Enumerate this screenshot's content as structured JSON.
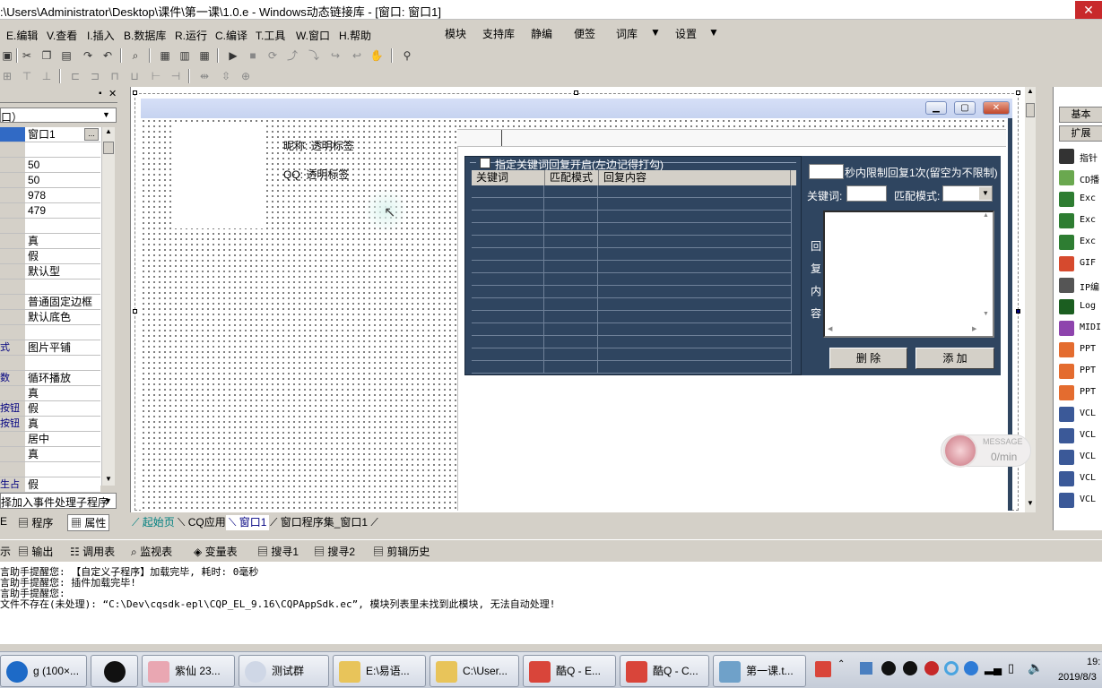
{
  "title": ":\\Users\\Administrator\\Desktop\\课件\\第一课\\1.0.e - Windows动态链接库 - [窗口: 窗口1]",
  "menu": {
    "left": [
      "E.编辑",
      "V.查看",
      "I.插入",
      "B.数据库",
      "R.运行",
      "C.编译",
      "T.工具",
      "W.窗口",
      "H.帮助"
    ],
    "right": [
      "模块",
      "支持库",
      "静编",
      "便签",
      "词库",
      "设置"
    ]
  },
  "props": {
    "selector": "口）",
    "rows": [
      {
        "name": "",
        "value": "窗口1"
      },
      {
        "name": "",
        "value": ""
      },
      {
        "name": "",
        "value": "50"
      },
      {
        "name": "",
        "value": "50"
      },
      {
        "name": "",
        "value": "978"
      },
      {
        "name": "",
        "value": "479"
      },
      {
        "name": "",
        "value": ""
      },
      {
        "name": "",
        "value": "真"
      },
      {
        "name": "",
        "value": "假"
      },
      {
        "name": "",
        "value": "默认型"
      },
      {
        "name": "",
        "value": ""
      },
      {
        "name": "",
        "value": "普通固定边框"
      },
      {
        "name": "",
        "value": "默认底色"
      },
      {
        "name": "",
        "value": ""
      },
      {
        "name": "式",
        "value": "图片平铺"
      },
      {
        "name": "",
        "value": ""
      },
      {
        "name": "数",
        "value": "循环播放"
      },
      {
        "name": "",
        "value": "真"
      },
      {
        "name": "按钮",
        "value": "假"
      },
      {
        "name": "按钮",
        "value": "真"
      },
      {
        "name": "",
        "value": "居中"
      },
      {
        "name": "",
        "value": "真"
      },
      {
        "name": "",
        "value": ""
      },
      {
        "name": "生占",
        "value": "假"
      }
    ],
    "event_select": "择加入事件处理子程序",
    "tabs": [
      "E",
      "程序",
      "属性"
    ]
  },
  "designer": {
    "nickname_label": "昵称: 透明标签",
    "qq_label": "QQ: 透明标签",
    "group_title": "指定关键词回复开启(左边记得打勾)",
    "grid_headers": [
      "关键词",
      "匹配模式",
      "回复内容"
    ],
    "limit_text": "秒内限制回复1次(留空为不限制)",
    "keyword_label": "关键词:",
    "match_label": "匹配模式:",
    "reply_vertical": [
      "回",
      "复",
      "内",
      "容"
    ],
    "delete_btn": "删 除",
    "add_btn": "添 加",
    "message_label": "MESSAGE",
    "message_rate": "0/min"
  },
  "bottom_tabs": [
    "起始页",
    "CQ应用",
    "窗口1",
    "窗口程序集_窗口1"
  ],
  "output_tabs": [
    "示",
    "输出",
    "调用表",
    "监视表",
    "变量表",
    "搜寻1",
    "搜寻2",
    "剪辑历史"
  ],
  "output_lines": [
    "言助手提醒您: 【自定义子程序】加载完毕, 耗时: 0毫秒",
    "言助手提醒您: 插件加载完毕!",
    "言助手提醒您:",
    "文件不存在(未处理): “C:\\Dev\\cqsdk-epl\\CQP_EL_9.16\\CQPAppSdk.ec”, 模块列表里未找到此模块, 无法自动处理!"
  ],
  "palette": {
    "tabs": [
      "基本",
      "扩展"
    ],
    "items": [
      "指针",
      "CD播",
      "Exc",
      "Exc",
      "Exc",
      "GIF",
      "IP编",
      "Log",
      "MIDI",
      "PPT",
      "PPT",
      "PPT",
      "VCL",
      "VCL",
      "VCL",
      "VCL",
      "VCL"
    ]
  },
  "taskbar": {
    "items": [
      "g (100×...",
      "",
      "紫仙 23...",
      "测试群",
      "E:\\易语...",
      "C:\\User...",
      "酷Q - E...",
      "酷Q - C...",
      "第一课.t..."
    ],
    "clock_time": "19:",
    "clock_date": "2019/8/3"
  }
}
